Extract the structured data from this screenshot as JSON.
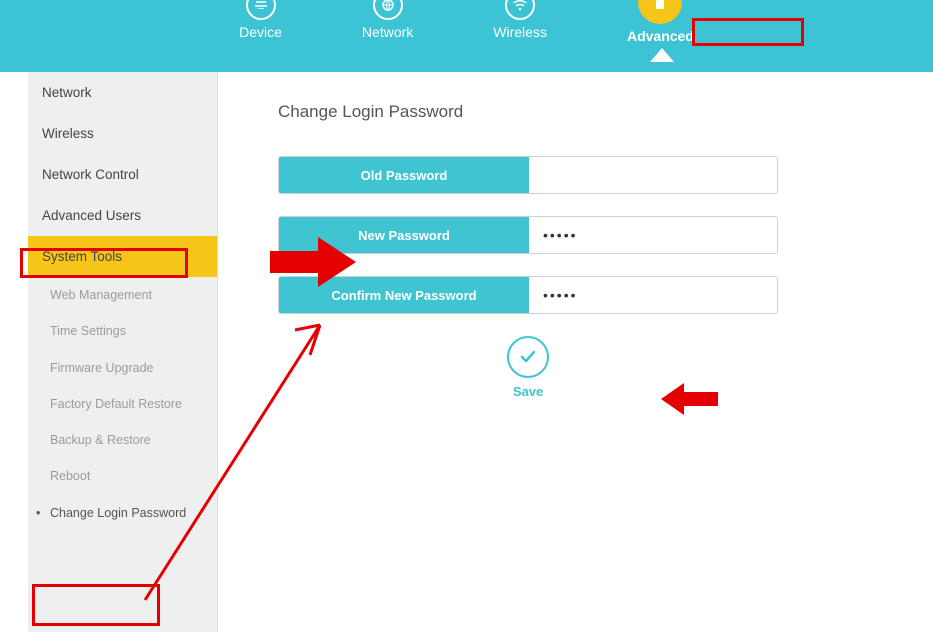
{
  "topnav": {
    "tabs": [
      {
        "label": "Device"
      },
      {
        "label": "Network"
      },
      {
        "label": "Wireless"
      },
      {
        "label": "Advanced",
        "active": true
      }
    ]
  },
  "sidebar": {
    "items": [
      {
        "label": "Network"
      },
      {
        "label": "Wireless"
      },
      {
        "label": "Network Control"
      },
      {
        "label": "Advanced Users"
      },
      {
        "label": "System Tools",
        "selected": true
      }
    ],
    "sub_items": [
      {
        "label": "Web Management"
      },
      {
        "label": "Time Settings"
      },
      {
        "label": "Firmware Upgrade"
      },
      {
        "label": "Factory Default Restore"
      },
      {
        "label": "Backup & Restore"
      },
      {
        "label": "Reboot"
      },
      {
        "label": "Change Login Password",
        "active": true
      }
    ]
  },
  "page": {
    "title": "Change Login Password",
    "fields": {
      "old_label": "Old Password",
      "old_value": "",
      "new_label": "New Password",
      "new_value": "•••••",
      "confirm_label": "Confirm New Password",
      "confirm_value": "•••••"
    },
    "save_label": "Save"
  },
  "colors": {
    "accent": "#3ec5d1",
    "highlight": "#f5c518",
    "annotation": "#e40000"
  }
}
